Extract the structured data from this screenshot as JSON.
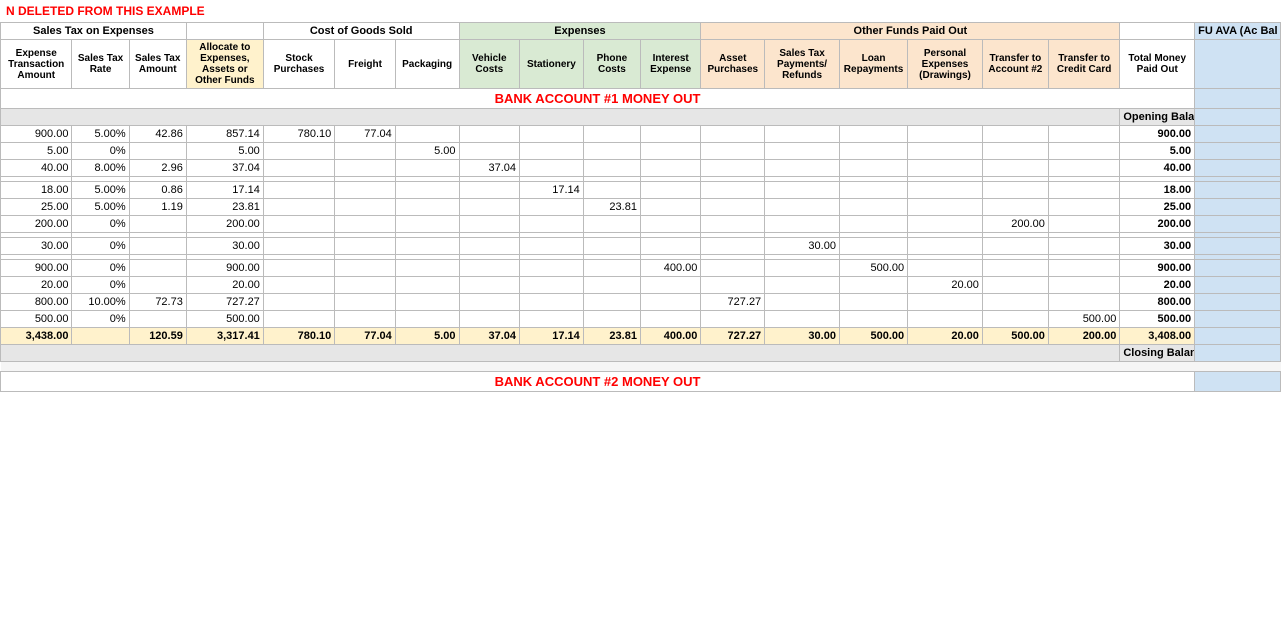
{
  "banner": "N DELETED FROM THIS EXAMPLE",
  "headers": {
    "group1_label": "Sales Tax on Expenses",
    "group2_label": "Cost of Goods Sold",
    "group3_label": "Expenses",
    "group4_label": "Other Funds Paid Out",
    "col_expense_txn": "Expense Transaction Amount",
    "col_sales_tax_rate": "Sales Tax Rate",
    "col_sales_tax_amt": "Sales Tax Amount",
    "col_alloc": "Allocate to Expenses, Assets or Other Funds",
    "col_stock": "Stock Purchases",
    "col_freight": "Freight",
    "col_packaging": "Packaging",
    "col_vehicle": "Vehicle Costs",
    "col_stationery": "Stationery",
    "col_phone": "Phone Costs",
    "col_interest": "Interest Expense",
    "col_asset": "Asset Purchases",
    "col_sales_pay_refunds": "Sales Tax Payments/ Refunds",
    "col_loan": "Loan Repayments",
    "col_personal": "Personal Expenses (Drawings)",
    "col_transfer2": "Transfer to Account #2",
    "col_transfer_cc": "Transfer to Credit Card",
    "col_total_money_out": "Total Money Paid Out",
    "col_fu_ava": "FU AVA (Ac Bal"
  },
  "bank1": {
    "title": "BANK ACCOUNT #1 MONEY OUT",
    "opening_balance_label": "Opening Balance",
    "closing_balance_label": "Closing Balance",
    "rows": [
      {
        "txn": "900.00",
        "rate": "5.00%",
        "tax": "42.86",
        "alloc": "857.14",
        "stock": "780.10",
        "freight": "77.04",
        "packaging": "",
        "vehicle": "",
        "stationery": "",
        "phone": "",
        "interest": "",
        "asset": "",
        "sales_pay": "",
        "loan": "",
        "personal": "",
        "transfer2": "",
        "transfer_cc": "",
        "total": "900.00"
      },
      {
        "txn": "5.00",
        "rate": "0%",
        "tax": "",
        "alloc": "5.00",
        "stock": "",
        "freight": "",
        "packaging": "5.00",
        "vehicle": "",
        "stationery": "",
        "phone": "",
        "interest": "",
        "asset": "",
        "sales_pay": "",
        "loan": "",
        "personal": "",
        "transfer2": "",
        "transfer_cc": "",
        "total": "5.00"
      },
      {
        "txn": "40.00",
        "rate": "8.00%",
        "tax": "2.96",
        "alloc": "37.04",
        "stock": "",
        "freight": "",
        "packaging": "",
        "vehicle": "37.04",
        "stationery": "",
        "phone": "",
        "interest": "",
        "asset": "",
        "sales_pay": "",
        "loan": "",
        "personal": "",
        "transfer2": "",
        "transfer_cc": "",
        "total": "40.00"
      },
      {
        "txn": "",
        "rate": "",
        "tax": "",
        "alloc": "",
        "stock": "",
        "freight": "",
        "packaging": "",
        "vehicle": "",
        "stationery": "",
        "phone": "",
        "interest": "",
        "asset": "",
        "sales_pay": "",
        "loan": "",
        "personal": "",
        "transfer2": "",
        "transfer_cc": "",
        "total": ""
      },
      {
        "txn": "18.00",
        "rate": "5.00%",
        "tax": "0.86",
        "alloc": "17.14",
        "stock": "",
        "freight": "",
        "packaging": "",
        "vehicle": "",
        "stationery": "17.14",
        "phone": "",
        "interest": "",
        "asset": "",
        "sales_pay": "",
        "loan": "",
        "personal": "",
        "transfer2": "",
        "transfer_cc": "",
        "total": "18.00"
      },
      {
        "txn": "25.00",
        "rate": "5.00%",
        "tax": "1.19",
        "alloc": "23.81",
        "stock": "",
        "freight": "",
        "packaging": "",
        "vehicle": "",
        "stationery": "",
        "phone": "23.81",
        "interest": "",
        "asset": "",
        "sales_pay": "",
        "loan": "",
        "personal": "",
        "transfer2": "",
        "transfer_cc": "",
        "total": "25.00"
      },
      {
        "txn": "200.00",
        "rate": "0%",
        "tax": "",
        "alloc": "200.00",
        "stock": "",
        "freight": "",
        "packaging": "",
        "vehicle": "",
        "stationery": "",
        "phone": "",
        "interest": "",
        "asset": "",
        "sales_pay": "",
        "loan": "",
        "personal": "",
        "transfer2": "200.00",
        "transfer_cc": "",
        "total": "200.00"
      },
      {
        "txn": "",
        "rate": "",
        "tax": "",
        "alloc": "",
        "stock": "",
        "freight": "",
        "packaging": "",
        "vehicle": "",
        "stationery": "",
        "phone": "",
        "interest": "",
        "asset": "",
        "sales_pay": "",
        "loan": "",
        "personal": "",
        "transfer2": "",
        "transfer_cc": "",
        "total": ""
      },
      {
        "txn": "30.00",
        "rate": "0%",
        "tax": "",
        "alloc": "30.00",
        "stock": "",
        "freight": "",
        "packaging": "",
        "vehicle": "",
        "stationery": "",
        "phone": "",
        "interest": "",
        "asset": "",
        "sales_pay": "30.00",
        "loan": "",
        "personal": "",
        "transfer2": "",
        "transfer_cc": "",
        "total": "30.00"
      },
      {
        "txn": "",
        "rate": "",
        "tax": "",
        "alloc": "",
        "stock": "",
        "freight": "",
        "packaging": "",
        "vehicle": "",
        "stationery": "",
        "phone": "",
        "interest": "",
        "asset": "",
        "sales_pay": "",
        "loan": "",
        "personal": "",
        "transfer2": "",
        "transfer_cc": "",
        "total": ""
      },
      {
        "txn": "900.00",
        "rate": "0%",
        "tax": "",
        "alloc": "900.00",
        "stock": "",
        "freight": "",
        "packaging": "",
        "vehicle": "",
        "stationery": "",
        "phone": "",
        "interest": "400.00",
        "asset": "",
        "sales_pay": "",
        "loan": "500.00",
        "personal": "",
        "transfer2": "",
        "transfer_cc": "",
        "total": "900.00"
      },
      {
        "txn": "20.00",
        "rate": "0%",
        "tax": "",
        "alloc": "20.00",
        "stock": "",
        "freight": "",
        "packaging": "",
        "vehicle": "",
        "stationery": "",
        "phone": "",
        "interest": "",
        "asset": "",
        "sales_pay": "",
        "loan": "",
        "personal": "20.00",
        "transfer2": "",
        "transfer_cc": "",
        "total": "20.00"
      },
      {
        "txn": "800.00",
        "rate": "10.00%",
        "tax": "72.73",
        "alloc": "727.27",
        "stock": "",
        "freight": "",
        "packaging": "",
        "vehicle": "",
        "stationery": "",
        "phone": "",
        "interest": "",
        "asset": "727.27",
        "sales_pay": "",
        "loan": "",
        "personal": "",
        "transfer2": "",
        "transfer_cc": "",
        "total": "800.00"
      },
      {
        "txn": "500.00",
        "rate": "0%",
        "tax": "",
        "alloc": "500.00",
        "stock": "",
        "freight": "",
        "packaging": "",
        "vehicle": "",
        "stationery": "",
        "phone": "",
        "interest": "",
        "asset": "",
        "sales_pay": "",
        "loan": "",
        "personal": "",
        "transfer2": "",
        "transfer_cc": "500.00",
        "total": "500.00"
      }
    ],
    "totals": {
      "txn": "3,438.00",
      "tax": "120.59",
      "alloc": "3,317.41",
      "stock": "780.10",
      "freight": "77.04",
      "packaging": "5.00",
      "vehicle": "37.04",
      "stationery": "17.14",
      "phone": "23.81",
      "interest": "400.00",
      "asset": "727.27",
      "sales_pay": "30.00",
      "loan": "500.00",
      "personal": "20.00",
      "transfer2": "500.00",
      "transfer_cc": "200.00",
      "total": "3,408.00"
    }
  },
  "bank2": {
    "title": "BANK ACCOUNT #2 MONEY OUT"
  }
}
